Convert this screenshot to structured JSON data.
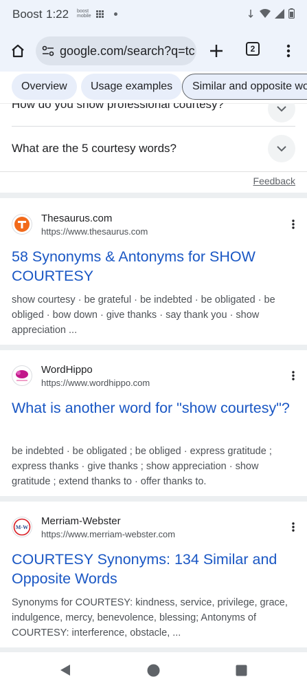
{
  "status": {
    "carrier": "Boost",
    "time": "1:22",
    "mini": "boost mobile"
  },
  "toolbar": {
    "url": "google.com/search?q=tc",
    "tab_count": "2"
  },
  "chips": [
    "Overview",
    "Usage examples",
    "Similar and opposite wo"
  ],
  "faq": {
    "partial_question": "How do you show professional courtesy?",
    "question": "What are the 5 courtesy words?",
    "feedback": "Feedback"
  },
  "results": [
    {
      "site": "Thesaurus.com",
      "url": "https://www.thesaurus.com",
      "title": "58 Synonyms & Antonyms for SHOW COURTESY",
      "snippet": "show courtesy · be grateful · be indebted · be obligated · be obliged · bow down · give thanks · say thank you · show appreciation ...",
      "favicon": "thesaurus-logo"
    },
    {
      "site": "WordHippo",
      "url": "https://www.wordhippo.com",
      "title": "What is another word for \"show courtesy\"?",
      "snippet": "be indebted · be obligated ; be obliged · express gratitude ; express thanks · give thanks ; show appreciation · show gratitude ; extend thanks to · offer thanks to.",
      "favicon": "wordhippo-logo"
    },
    {
      "site": "Merriam-Webster",
      "url": "https://www.merriam-webster.com",
      "title": "COURTESY Synonyms: 134 Similar and Opposite Words",
      "snippet": "Synonyms for COURTESY: kindness, service, privilege, grace, indulgence, mercy, benevolence, blessing; Antonyms of COURTESY: interference, obstacle, ...",
      "favicon": "merriam-webster-logo",
      "favicon_text": "M·W"
    }
  ],
  "colors": {
    "link": "#1a57c4",
    "chrome_bg": "#eef3fb",
    "chip_bg": "#e8eefa"
  }
}
